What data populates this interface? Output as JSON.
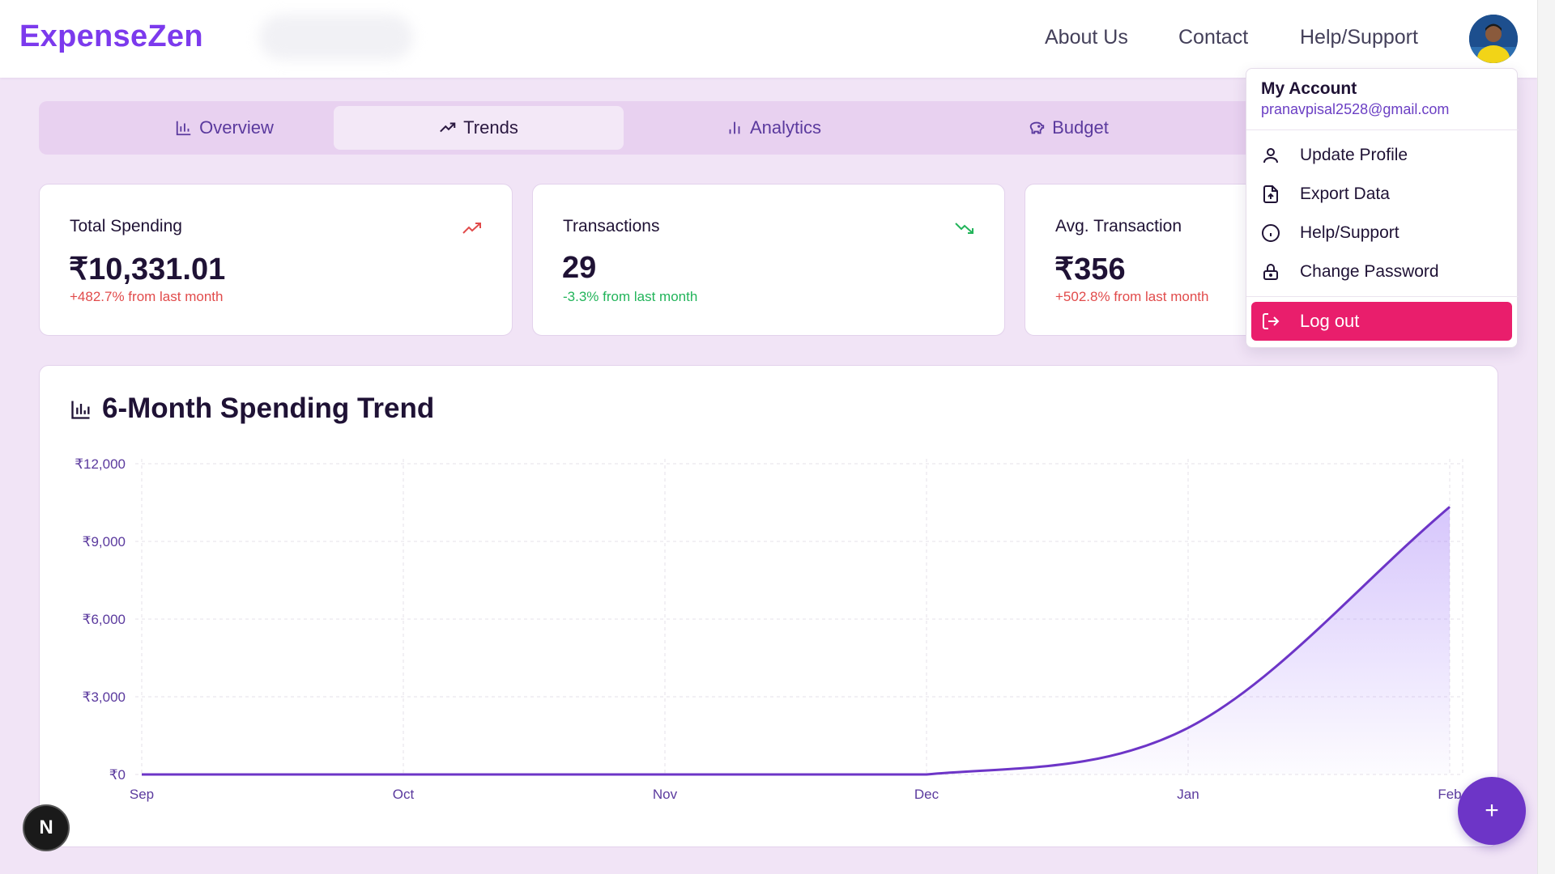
{
  "header": {
    "brand": "ExpenseZen",
    "nav": [
      "About Us",
      "Contact",
      "Help/Support"
    ]
  },
  "tabs": [
    {
      "label": "Overview",
      "icon": "bar-chart-icon",
      "active": false
    },
    {
      "label": "Trends",
      "icon": "trending-up-icon",
      "active": true
    },
    {
      "label": "Analytics",
      "icon": "analytics-icon",
      "active": false
    },
    {
      "label": "Budget",
      "icon": "piggy-bank-icon",
      "active": false
    }
  ],
  "stats": [
    {
      "label": "Total Spending",
      "value": "₹10,331.01",
      "delta": "+482.7% from last month",
      "trend": "up",
      "color": "#e14b4b"
    },
    {
      "label": "Transactions",
      "value": "29",
      "delta": "-3.3% from last month",
      "trend": "down",
      "color": "#22b45a"
    },
    {
      "label": "Avg. Transaction",
      "value": "₹356",
      "delta": "+502.8% from last month",
      "trend": "up",
      "color": "#e14b4b"
    }
  ],
  "chart_title": "6-Month Spending Trend",
  "chart_data": {
    "type": "area",
    "categories": [
      "Sep",
      "Oct",
      "Nov",
      "Dec",
      "Jan",
      "Feb"
    ],
    "values": [
      0,
      0,
      0,
      0,
      1800,
      10331
    ],
    "ylim": [
      0,
      12000
    ],
    "yticks": [
      "₹0",
      "₹3,000",
      "₹6,000",
      "₹9,000",
      "₹12,000"
    ],
    "ytick_values": [
      0,
      3000,
      6000,
      9000,
      12000
    ],
    "grid": true,
    "line_color": "#6d35c7"
  },
  "dropdown": {
    "title": "My Account",
    "email": "pranavpisal2528@gmail.com",
    "items": [
      {
        "label": "Update Profile",
        "icon": "user-icon"
      },
      {
        "label": "Export Data",
        "icon": "file-export-icon"
      },
      {
        "label": "Help/Support",
        "icon": "info-icon"
      },
      {
        "label": "Change Password",
        "icon": "lock-icon"
      }
    ],
    "logout": "Log out"
  },
  "fab": "+",
  "badge": "N"
}
